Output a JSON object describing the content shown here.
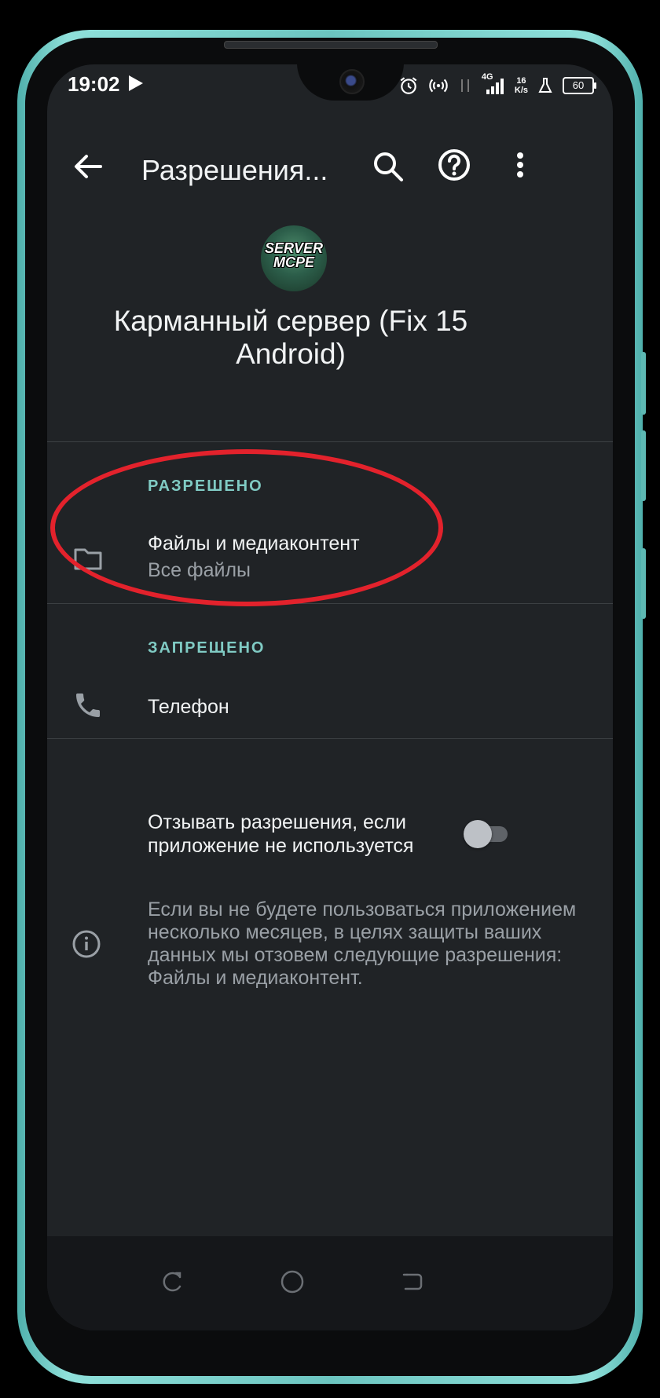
{
  "status_bar": {
    "time": "19:02",
    "network": "4G",
    "speed_value": "16",
    "speed_unit": "K/s",
    "battery": "60"
  },
  "app_bar": {
    "title": "Разрешения..."
  },
  "app": {
    "icon_text_line1": "SERVER",
    "icon_text_line2": "MCPE",
    "name": "Карманный сервер (Fix 15 Android)"
  },
  "sections": {
    "allowed_label": "РАЗРЕШЕНО",
    "denied_label": "ЗАПРЕЩЕНО"
  },
  "allowed_items": [
    {
      "title": "Файлы и медиаконтент",
      "subtitle": "Все файлы",
      "icon": "folder-icon"
    }
  ],
  "denied_items": [
    {
      "title": "Телефон",
      "icon": "phone-icon"
    }
  ],
  "revoke": {
    "label": "Отзывать разрешения, если приложение не используется",
    "enabled": false
  },
  "info": {
    "text": "Если вы не будете пользоваться приложением несколько месяцев, в целях защиты ваших данных мы отзовем следующие разрешения: Файлы и медиаконтент."
  },
  "colors": {
    "background": "#202326",
    "accent": "#80cbc4",
    "annotation": "#e3222c",
    "frame": "#6cc5c0"
  }
}
